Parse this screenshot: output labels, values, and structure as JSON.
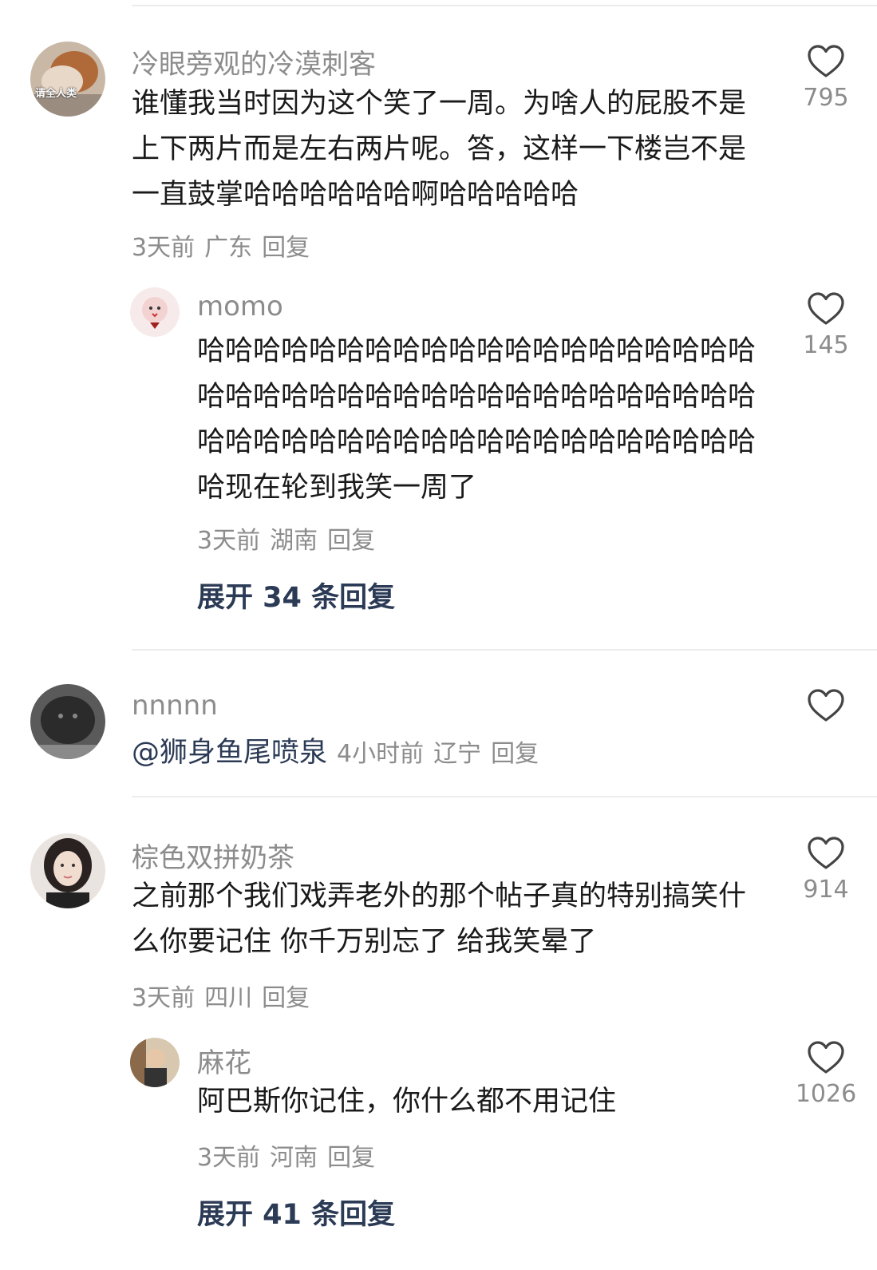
{
  "comments": [
    {
      "username": "冷眼旁观的冷漠刺客",
      "text": "谁懂我当时因为这个笑了一周。为啥人的屁股不是上下两片而是左右两片呢。答，这样一下楼岂不是一直鼓掌哈哈哈哈哈哈啊哈哈哈哈哈",
      "time": "3天前",
      "location": "广东",
      "reply_label": "回复",
      "likes": "795",
      "avatar_text": "请全人类",
      "reply": {
        "username": "momo",
        "text": "哈哈哈哈哈哈哈哈哈哈哈哈哈哈哈哈哈哈哈哈哈哈哈哈哈哈哈哈哈哈哈哈哈哈哈哈哈哈哈哈哈哈哈哈哈哈哈哈哈哈哈哈哈哈哈哈哈哈哈哈哈现在轮到我笑一周了",
        "time": "3天前",
        "location": "湖南",
        "reply_label": "回复",
        "likes": "145"
      },
      "expand": "展开 34 条回复"
    },
    {
      "username": "nnnnn",
      "mention": "@狮身鱼尾喷泉",
      "time": "4小时前",
      "location": "辽宁",
      "reply_label": "回复"
    },
    {
      "username": "棕色双拼奶茶",
      "text": "之前那个我们戏弄老外的那个帖子真的特别搞笑什么你要记住 你千万别忘了 给我笑晕了",
      "time": "3天前",
      "location": "四川",
      "reply_label": "回复",
      "likes": "914",
      "reply": {
        "username": "麻花",
        "text": "阿巴斯你记住，你什么都不用记住",
        "time": "3天前",
        "location": "河南",
        "reply_label": "回复",
        "likes": "1026"
      },
      "expand": "展开 41 条回复"
    }
  ],
  "colors": {
    "text": "#1a1a1a",
    "muted": "#8c8c8c",
    "link": "#2b3a55"
  }
}
